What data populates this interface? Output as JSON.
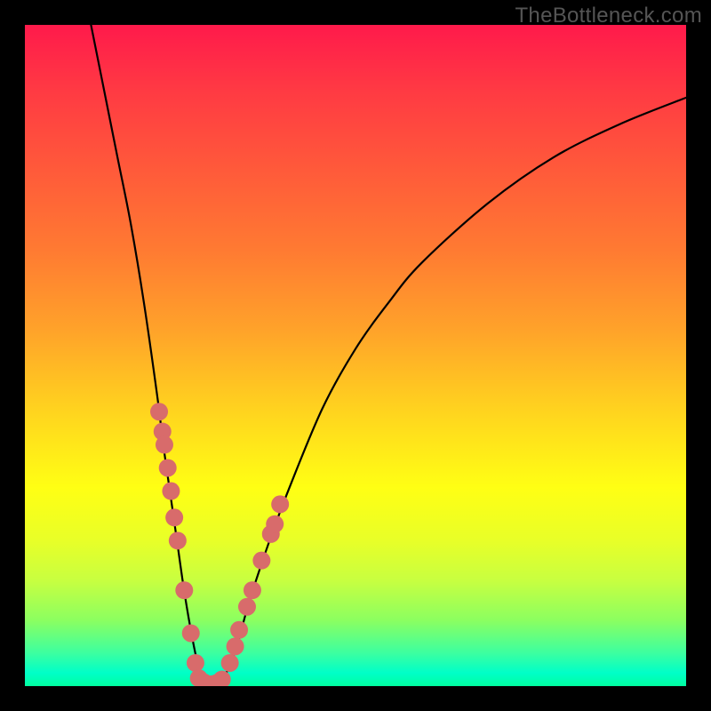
{
  "watermark": "TheBottleneck.com",
  "chart_data": {
    "type": "line",
    "title": "",
    "xlabel": "",
    "ylabel": "",
    "xlim": [
      0,
      100
    ],
    "ylim": [
      0,
      100
    ],
    "curve": {
      "x": [
        10,
        12,
        14,
        16,
        18,
        20,
        21,
        22,
        23,
        24,
        25,
        26,
        27,
        28,
        29,
        30,
        32,
        34,
        37,
        40,
        45,
        50,
        55,
        60,
        70,
        80,
        90,
        100
      ],
      "y": [
        100,
        90,
        80,
        70,
        58,
        44,
        36,
        29,
        22,
        15,
        9,
        4,
        1,
        0,
        0,
        1,
        6,
        13,
        22,
        30,
        42,
        51,
        58,
        64,
        73,
        80,
        85,
        89
      ]
    },
    "markers_left": {
      "x": [
        20.3,
        20.8,
        21.1,
        21.6,
        22.1,
        22.6,
        23.1,
        24.1,
        25.1,
        25.8
      ],
      "y": [
        41.5,
        38.5,
        36.5,
        33.0,
        29.5,
        25.5,
        22.0,
        14.5,
        8.0,
        3.5
      ]
    },
    "markers_right": {
      "x": [
        31.0,
        31.8,
        32.4,
        33.6,
        34.4,
        35.8,
        37.2,
        37.8,
        38.6
      ],
      "y": [
        3.5,
        6.0,
        8.5,
        12.0,
        14.5,
        19.0,
        23.0,
        24.5,
        27.5
      ]
    },
    "markers_bottom": {
      "x": [
        26.3,
        27.0,
        27.7,
        28.4,
        29.1,
        29.8
      ],
      "y": [
        1.2,
        0.6,
        0.3,
        0.3,
        0.5,
        1.0
      ]
    },
    "marker_color": "#d86b6b",
    "marker_radius_px": 10
  }
}
